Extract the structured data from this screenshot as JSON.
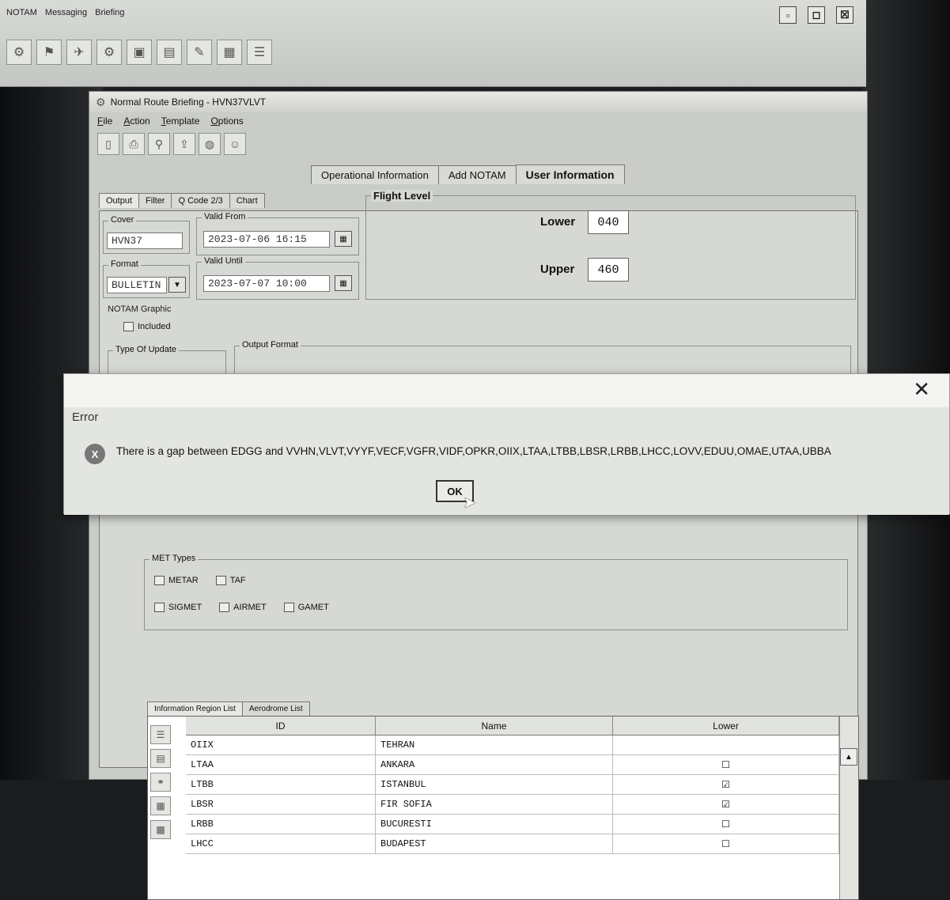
{
  "app": {
    "menu": [
      "NOTAM",
      "Messaging",
      "Briefing"
    ],
    "window_controls": [
      "minimize",
      "maximize",
      "close"
    ]
  },
  "briefing": {
    "title": "Normal Route Briefing - HVN37VLVT",
    "menu": [
      "File",
      "Action",
      "Template",
      "Options"
    ],
    "top_tabs": [
      "Operational Information",
      "Add NOTAM",
      "User Information"
    ],
    "tabs": [
      "Output",
      "Filter",
      "Q Code 2/3",
      "Chart"
    ],
    "active_tab": "Output",
    "cover": {
      "label": "Cover",
      "value": "HVN37"
    },
    "format": {
      "label": "Format",
      "value": "BULLETIN"
    },
    "valid_from": {
      "label": "Valid From",
      "value": "2023-07-06 16:15"
    },
    "valid_until": {
      "label": "Valid Until",
      "value": "2023-07-07 10:00"
    },
    "flight_level": {
      "label": "Flight Level",
      "lower_label": "Lower",
      "lower": "040",
      "upper_label": "Upper",
      "upper": "460"
    },
    "notam_graphic": {
      "label": "NOTAM Graphic",
      "included_label": "Included"
    },
    "type_of_update": {
      "label": "Type Of Update"
    },
    "output_format": {
      "label": "Output Format"
    },
    "met_types": {
      "label": "MET Types",
      "options": [
        "METAR",
        "TAF",
        "SIGMET",
        "AIRMET",
        "GAMET"
      ]
    },
    "sub_tabs": [
      "Information Region List",
      "Aerodrome List"
    ],
    "table": {
      "columns": [
        "ID",
        "Name",
        "Lower"
      ],
      "rows": [
        {
          "id": "OIIX",
          "name": "TEHRAN",
          "lower": "",
          "checked": false
        },
        {
          "id": "LTAA",
          "name": "ANKARA",
          "lower": "☐",
          "checked": false
        },
        {
          "id": "LTBB",
          "name": "ISTANBUL",
          "lower": "☑",
          "checked": true
        },
        {
          "id": "LBSR",
          "name": "FIR SOFIA",
          "lower": "☑",
          "checked": true
        },
        {
          "id": "LRBB",
          "name": "BUCURESTI",
          "lower": "☐",
          "checked": false
        },
        {
          "id": "LHCC",
          "name": "BUDAPEST",
          "lower": "☐",
          "checked": false
        }
      ]
    }
  },
  "dialog": {
    "title": "Error",
    "icon": "error-x-icon",
    "message": "There is a gap between EDGG and VVHN,VLVT,VYYF,VECF,VGFR,VIDF,OPKR,OIIX,LTAA,LTBB,LBSR,LRBB,LHCC,LOVV,EDUU,OMAE,UTAA,UBBA",
    "ok_label": "OK",
    "close_symbol": "✕"
  }
}
